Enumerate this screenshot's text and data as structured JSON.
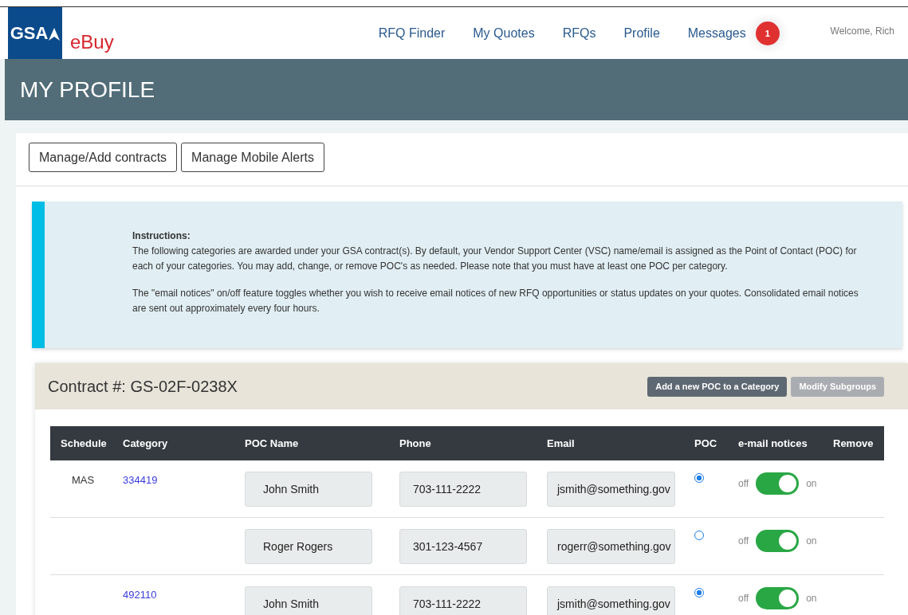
{
  "header": {
    "logo": "GSA",
    "app_name": "eBuy",
    "nav": [
      {
        "label": "RFQ Finder"
      },
      {
        "label": "My Quotes"
      },
      {
        "label": "RFQs"
      },
      {
        "label": "Profile"
      },
      {
        "label": "Messages",
        "badge": "1"
      }
    ],
    "welcome": "Welcome, Rich"
  },
  "page_title": "MY PROFILE",
  "actions": [
    "Manage/Add contracts",
    "Manage Mobile Alerts"
  ],
  "instructions": {
    "heading": "Instructions:",
    "paragraphs": [
      "The following categories are awarded under your GSA contract(s). By default, your Vendor Support Center (VSC) name/email is assigned as the Point of Contact (POC) for each of your categories. You may add, change, or remove POC's as needed. Please note that you must have at least one POC per category.",
      "The \"email notices\" on/off feature toggles whether you wish to receive email notices of new RFQ opportunities or status updates on your quotes. Consolidated email notices are sent out approximately every four hours."
    ]
  },
  "contract": {
    "title": "Contract #: GS-02F-0238X",
    "buttons": [
      {
        "label": "Add a new POC to a Category",
        "disabled": false
      },
      {
        "label": "Modify Subgroups",
        "disabled": true
      }
    ],
    "table": {
      "columns": [
        "Schedule",
        "Category",
        "POC Name",
        "Phone",
        "Email",
        "POC",
        "e-mail notices",
        "Remove"
      ],
      "rows": [
        {
          "schedule": "MAS",
          "category": "334419",
          "poc_name": "John Smith",
          "phone": "703-111-2222",
          "email": "jsmith@something.gov",
          "poc": true,
          "notices_on": true,
          "off_label": "off",
          "on_label": "on"
        },
        {
          "poc_name": "Roger Rogers",
          "phone": "301-123-4567",
          "email": "rogerr@something.gov",
          "poc": false,
          "notices_on": true,
          "off_label": "off",
          "on_label": "on"
        },
        {
          "category": "492110",
          "poc_name": "John Smith",
          "phone": "703-111-2222",
          "email": "jsmith@something.gov",
          "poc": true,
          "notices_on": true,
          "off_label": "off",
          "on_label": "on"
        }
      ]
    }
  }
}
